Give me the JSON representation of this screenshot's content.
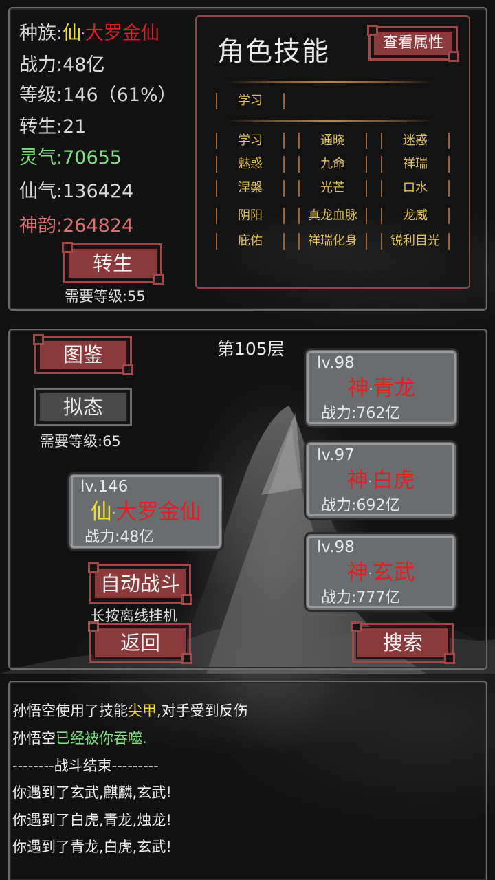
{
  "stats": {
    "race_label": "种族:",
    "race_prefix": "仙",
    "race_name": "大罗金仙",
    "power": "战力:48亿",
    "level": "等级:146（61%）",
    "rebirth": "转生:21",
    "lingqi": "灵气:70655",
    "xianqi": "仙气:136424",
    "shenyun": "神韵:264824"
  },
  "rebirth_button": {
    "label": "转生",
    "requirement": "需要等级:55"
  },
  "skills": {
    "title": "角色技能",
    "view_button": "查看属性",
    "learning": "学习",
    "grid": [
      [
        "学习",
        "通晓",
        "迷惑"
      ],
      [
        "魅惑",
        "九命",
        "祥瑞"
      ],
      [
        "涅槃",
        "光芒",
        "口水"
      ],
      [
        "阴阳",
        "真龙血脉",
        "龙威"
      ],
      [
        "庇佑",
        "祥瑞化身",
        "锐利目光"
      ]
    ]
  },
  "tower": {
    "floor": "第105层",
    "atlas_button": "图鉴",
    "mimic_button": "拟态",
    "mimic_requirement": "需要等级:65",
    "auto_battle_button": "自动战斗",
    "auto_battle_hint": "长按离线挂机",
    "back_button": "返回",
    "search_button": "搜索"
  },
  "player_card": {
    "lv": "lv.146",
    "prefix": "仙",
    "name": "大罗金仙",
    "power": "战力:48亿"
  },
  "enemies": [
    {
      "lv": "lv.98",
      "prefix": "神",
      "name": "青龙",
      "power": "战力:762亿"
    },
    {
      "lv": "lv.97",
      "prefix": "神",
      "name": "白虎",
      "power": "战力:692亿"
    },
    {
      "lv": "lv.98",
      "prefix": "神",
      "name": "玄武",
      "power": "战力:777亿"
    }
  ],
  "log": {
    "line1_a": "孙悟空使用了技能",
    "line1_skill": "尖甲",
    "line1_b": ",对手受到反伤",
    "line2_a": "孙悟空",
    "line2_b": "已经被你吞噬.",
    "line3": "--------战斗结束---------",
    "line4": "你遇到了玄武,麒麟,玄武!",
    "line5": "你遇到了白虎,青龙,烛龙!",
    "line6": "你遇到了青龙,白虎,玄武!"
  },
  "colors": {
    "immortal_prefix": "#f0e020",
    "name_red": "#e02020",
    "lingqi_green": "#80e080",
    "shenyun_pink": "#e07070",
    "button_red": "#8a3a3a",
    "skill_gold": "#e0c050"
  }
}
